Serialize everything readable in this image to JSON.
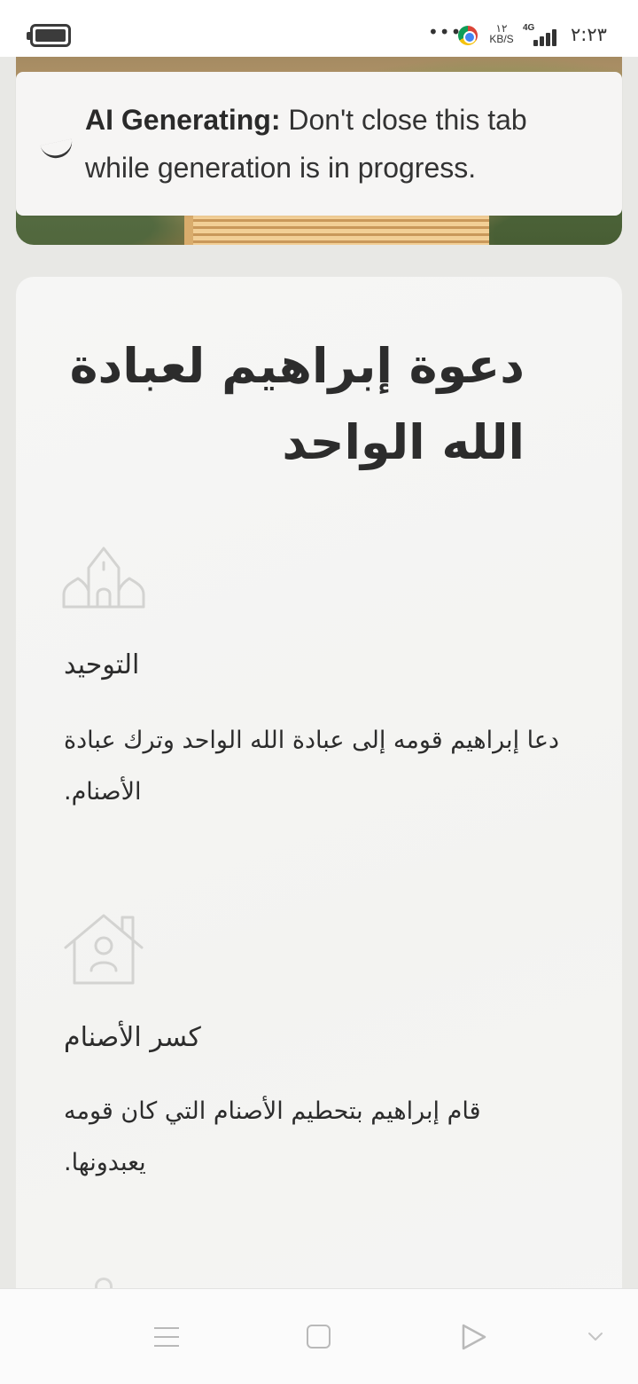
{
  "status_bar": {
    "dots": "•••",
    "network_speed_value": "١٢",
    "network_speed_unit": "KB/S",
    "network_type": "4G",
    "time": "٢:٢٣",
    "icons": [
      "battery-icon",
      "chrome-icon",
      "signal-icon"
    ]
  },
  "ai_notice": {
    "label": "AI Generating:",
    "message": " Don't close this tab while generation is in progress."
  },
  "page": {
    "title": "دعوة إبراهيم لعبادة الله الواحد"
  },
  "features": [
    {
      "icon": "mosque-icon",
      "title": "التوحيد",
      "description": "دعا إبراهيم قومه إلى عبادة الله الواحد وترك عبادة الأصنام."
    },
    {
      "icon": "house-user-icon",
      "title": "كسر الأصنام",
      "description": "قام إبراهيم بتحطيم الأصنام التي كان قومه يعبدونها."
    }
  ],
  "nav_bar": {
    "icons": [
      "menu-icon",
      "home-square-icon",
      "back-triangle-icon",
      "hide-chevron-icon"
    ]
  },
  "colors": {
    "background": "#e8e8e5",
    "card": "#f5f5f4",
    "text": "#2c2c2c",
    "icon_muted": "#cfcfcd"
  }
}
